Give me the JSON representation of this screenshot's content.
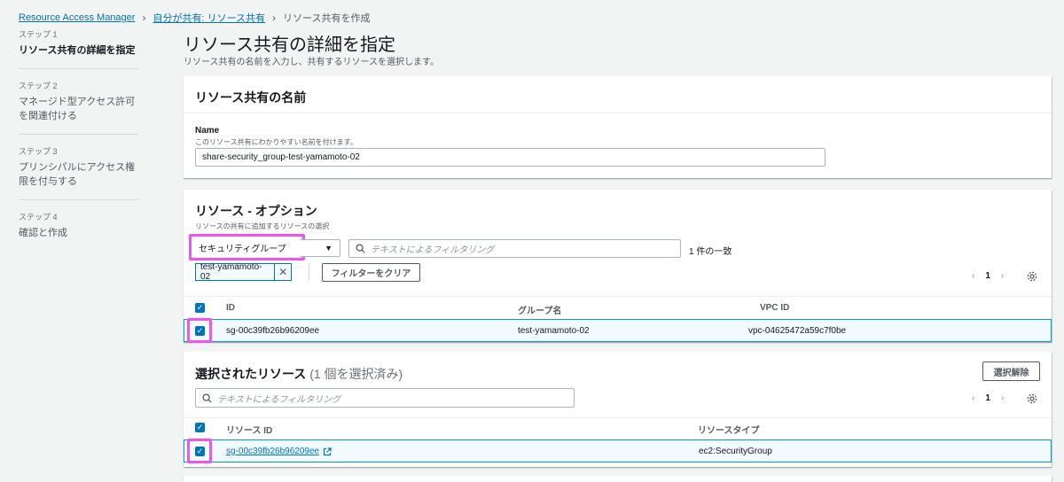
{
  "breadcrumb": {
    "root": "Resource Access Manager",
    "parent": "自分が共有: リソース共有",
    "current": "リソース共有を作成"
  },
  "steps": [
    {
      "num": "ステップ 1",
      "title": "リソース共有の詳細を指定"
    },
    {
      "num": "ステップ 2",
      "title": "マネージド型アクセス許可を関連付ける"
    },
    {
      "num": "ステップ 3",
      "title": "プリンシパルにアクセス権限を付与する"
    },
    {
      "num": "ステップ 4",
      "title": "確認と作成"
    }
  ],
  "page": {
    "title": "リソース共有の詳細を指定",
    "description": "リソース共有の名前を入力し、共有するリソースを選択します。"
  },
  "name_panel": {
    "header": "リソース共有の名前",
    "label": "Name",
    "description": "このリソース共有にわかりやすい名前を付けます。",
    "value": "share-security_group-test-yamamoto-02"
  },
  "resources_panel": {
    "header": "リソース - オプション",
    "description": "リソースの共有に追加するリソースの選択",
    "resource_type": "セキュリティグループ",
    "filter_placeholder": "テキストによるフィルタリング",
    "match_count": "1 件の一致",
    "token": "test-yamamoto-02",
    "clear_filter": "フィルターをクリア",
    "page": "1",
    "columns": [
      "ID",
      "グループ名",
      "VPC ID"
    ],
    "rows": [
      {
        "id": "sg-00c39fb26b96209ee",
        "group_name": "test-yamamoto-02",
        "vpc_id": "vpc-04625472a59c7f0be"
      }
    ]
  },
  "selected_panel": {
    "header": "選択されたリソース",
    "count": "(1 個を選択済み)",
    "deselect": "選択解除",
    "filter_placeholder": "テキストによるフィルタリング",
    "page": "1",
    "columns": [
      "リソース ID",
      "リソースタイプ"
    ],
    "rows": [
      {
        "resource_id": "sg-00c39fb26b96209ee",
        "resource_type": "ec2:SecurityGroup"
      }
    ]
  },
  "icons": {
    "checkbox": "✓",
    "caret": "▼",
    "prev": "‹",
    "next": "›",
    "close": "✕",
    "search": "search-icon",
    "settings": "gear-icon",
    "external": "external-link-icon"
  },
  "colors": {
    "link": "#0073bb",
    "highlight": "#ee55ee",
    "selected_row_bg": "#f1faff",
    "selected_row_border": "#00a1c9"
  }
}
